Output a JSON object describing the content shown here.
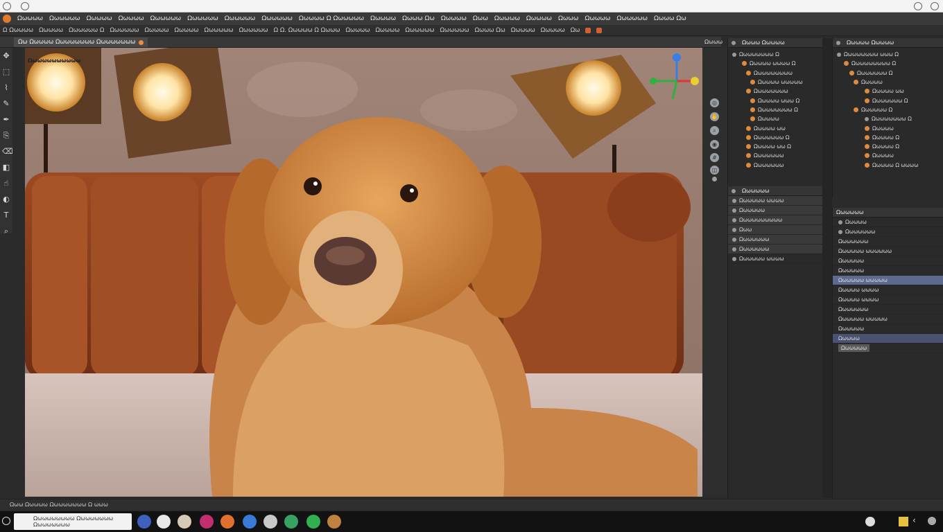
{
  "menu": {
    "items": [
      "Ωωωωω",
      "Ωωωωωω",
      "Ωωωωω",
      "Ωωωωω",
      "Ωωωωωω",
      "Ωωωωωω",
      "Ωωωωωω",
      "Ωωωωωω",
      "Ωωωωω Ω Ωωωωωω",
      "Ωωωωω",
      "Ωωωω Ωω",
      "Ωωωωω",
      "Ωωω",
      "Ωωωωω",
      "Ωωωωω",
      "Ωωωω",
      "Ωωωωω",
      "Ωωωωωω",
      "Ωωωω Ωω"
    ]
  },
  "options": {
    "items": [
      "Ω Ωωωωω",
      "Ωωωωω",
      "Ωωωωωω Ω",
      "Ωωωωωω",
      "Ωωωωω",
      "Ωωωωω",
      "Ωωωωωω",
      "Ωωωωωω",
      "Ω Ω. Ωωωωω Ω Ωωωω",
      "Ωωωωω",
      "Ωωωωω",
      "Ωωωωωω",
      "Ωωωωωω",
      "Ωωωω Ωω",
      "Ωωωωω",
      "Ωωωωω",
      "Ωω"
    ]
  },
  "document": {
    "tab_label": "Ωω Ωωωωω Ωωωωωωωω Ωωωωωωωω",
    "caption": "Ωωωωωωωωωωω",
    "right_label": "Ωωωω"
  },
  "outliner": {
    "header": "Ωωωω Ωωωωω",
    "rows": [
      "Ωωωωωωωω Ω",
      "Ωωωωω ωωωω Ω",
      "Ωωωωωωωωω",
      "Ωωωωω ωωωωω",
      "Ωωωωωωωω",
      "Ωωωωω ωωω Ω",
      "Ωωωωωωωω Ω",
      "Ωωωωω",
      "Ωωωωω ωω",
      "Ωωωωωωω Ω",
      "Ωωωωω ωω Ω",
      "Ωωωωωωω",
      "Ωωωωωωω"
    ]
  },
  "scene": {
    "header": "Ωωωωω Ωωωωω",
    "rows": [
      "Ωωωωωωωω ωωω Ω",
      "Ωωωωωωωωω Ω",
      "Ωωωωωωω Ω",
      "Ωωωωω",
      "Ωωωωω ωω",
      "Ωωωωωωω Ω",
      "Ωωωωωω Ω",
      "Ωωωωωωωω Ω",
      "Ωωωωω",
      "Ωωωωω Ω",
      "Ωωωωω Ω",
      "Ωωωωω",
      "Ωωωωω Ω ωωωω"
    ]
  },
  "properties": {
    "header": "Ωωωωωω",
    "rows": [
      "Ωωωωωω ωωωω",
      "Ωωωωωω",
      "Ωωωωωωωωωω",
      "Ωωω",
      "Ωωωωωωω",
      "Ωωωωωωω",
      "Ωωωωωω ωωωω"
    ]
  },
  "layers": {
    "header": "Ωωωωωω",
    "rows": [
      "Ωωωωω",
      "Ωωωωωωω",
      "Ωωωωωωω",
      "Ωωωωωω ωωωωωω",
      "Ωωωωωω",
      "Ωωωωωω",
      "Ωωωωωω ωωωωω",
      "Ωωωωω ωωωω",
      "Ωωωωω ωωωω",
      "Ωωωωωωω",
      "Ωωωωωω ωωωωω",
      "Ωωωωωω",
      "Ωωωωω",
      "Ωωωωωω"
    ]
  },
  "status": {
    "text": "Ωωω Ωωωωω Ωωωωωωωω Ω ωωω"
  },
  "taskbar": {
    "search_placeholder": "Ωωωωωωωωω Ωωωωωωωω Ωωωωωωωω"
  },
  "colors": {
    "accent": "#e07a2e",
    "selection": "#5d6a8e"
  }
}
